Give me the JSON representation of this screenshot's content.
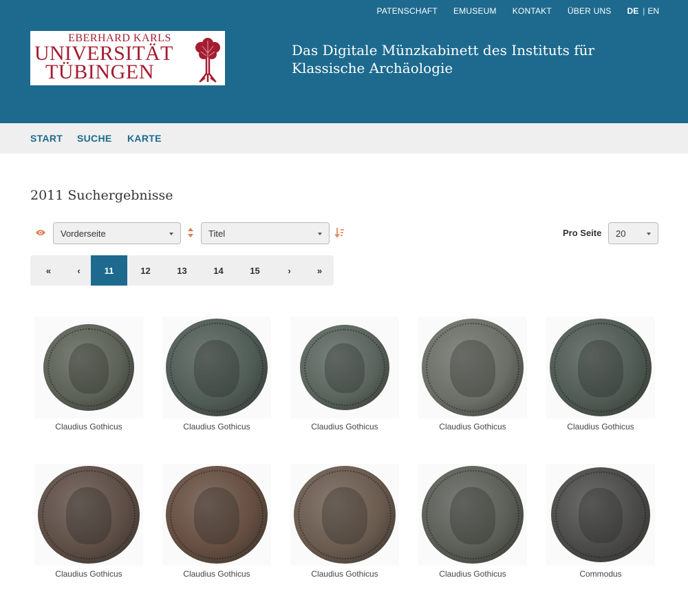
{
  "topnav": {
    "items": [
      "PATENSCHAFT",
      "EMUSEUM",
      "KONTAKT",
      "ÜBER UNS"
    ],
    "lang_active": "DE",
    "lang_sep": "|",
    "lang_other": "EN"
  },
  "logo": {
    "line1": "EBERHARD KARLS",
    "line2": "UNIVERSITÄT",
    "line3": "TÜBINGEN"
  },
  "site_title": {
    "line1": "Das Digitale Münzkabinett des Instituts für",
    "line2": "Klassische Archäologie"
  },
  "mainnav": [
    "START",
    "SUCHE",
    "KARTE"
  ],
  "results": {
    "title": "2011 Suchergebnisse"
  },
  "controls": {
    "view_select": "Vorderseite",
    "sort_select": "Titel",
    "per_page_label": "Pro Seite",
    "per_page_value": "20"
  },
  "pagination": {
    "items": [
      "«",
      "‹",
      "11",
      "12",
      "13",
      "14",
      "15",
      "›",
      "»"
    ],
    "active": "11"
  },
  "coins": [
    {
      "caption": "Claudius Gothicus",
      "color": "#5b6157"
    },
    {
      "caption": "Claudius Gothicus",
      "color": "#4f5b55"
    },
    {
      "caption": "Claudius Gothicus",
      "color": "#5a645d"
    },
    {
      "caption": "Claudius Gothicus",
      "color": "#6a6e66"
    },
    {
      "caption": "Claudius Gothicus",
      "color": "#4f5a53"
    },
    {
      "caption": "Claudius Gothicus",
      "color": "#5d4d45"
    },
    {
      "caption": "Claudius Gothicus",
      "color": "#654d40"
    },
    {
      "caption": "Claudius Gothicus",
      "color": "#6a5a4e"
    },
    {
      "caption": "Claudius Gothicus",
      "color": "#5b5e57"
    },
    {
      "caption": "Commodus",
      "color": "#4a4a48"
    }
  ],
  "colors": {
    "header_bg": "#1d6a8e",
    "accent": "#1d6a8e",
    "logo_red": "#a51c30",
    "icon_orange": "#e07b4f"
  }
}
